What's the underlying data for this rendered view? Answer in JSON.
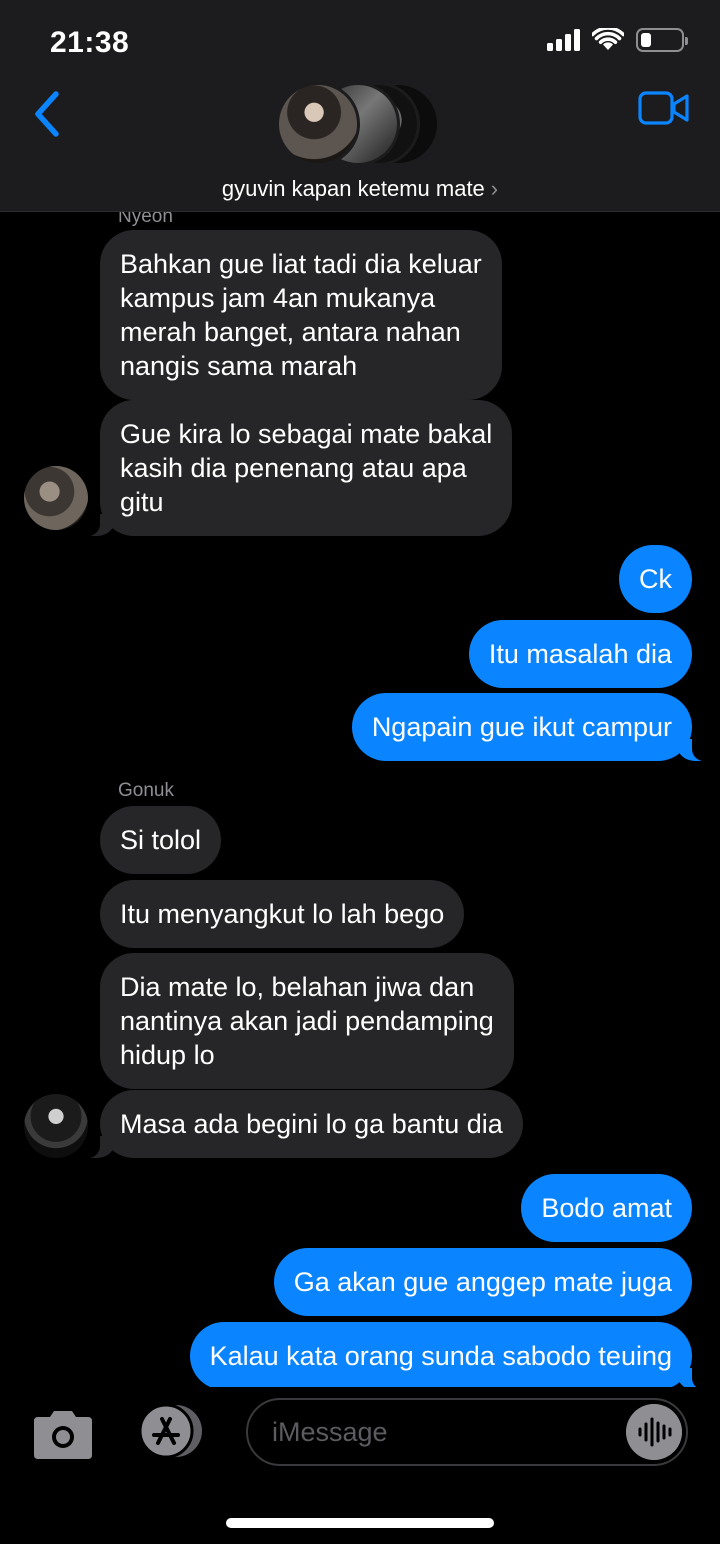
{
  "status_bar": {
    "time": "21:38",
    "battery_level": 0.25
  },
  "header": {
    "group_name": "gyuvin kapan ketemu mate",
    "chevron": "›"
  },
  "messages": [
    {
      "sender": "Nyeon"
    },
    {
      "text": "Bahkan gue liat tadi dia keluar\nkampus jam 4an mukanya\nmerah banget, antara nahan\nnangis sama marah"
    },
    {
      "text": "Gue kira lo sebagai mate bakal\nkasih dia penenang atau apa\ngitu"
    },
    {
      "text": "Ck"
    },
    {
      "text": "Itu masalah dia"
    },
    {
      "text": "Ngapain gue ikut campur"
    },
    {
      "sender": "Gonuk"
    },
    {
      "text": "Si tolol"
    },
    {
      "text": "Itu menyangkut lo lah bego"
    },
    {
      "text": "Dia mate lo, belahan jiwa dan\nnantinya akan jadi pendamping\nhidup lo"
    },
    {
      "text": "Masa ada begini lo ga bantu dia"
    },
    {
      "text": "Bodo amat"
    },
    {
      "text": "Ga akan gue anggep mate juga"
    },
    {
      "text": "Kalau kata orang sunda sabodo teuing"
    }
  ],
  "input": {
    "placeholder": "iMessage"
  },
  "colors": {
    "outgoing": "#0a84ff",
    "incoming": "#262628",
    "accent": "#0a84ff",
    "header_bg": "#1c1c1e"
  },
  "icons": [
    "back-chevron-icon",
    "video-camera-icon",
    "camera-icon",
    "app-store-icon",
    "audio-waveform-icon",
    "signal-icon",
    "wifi-icon",
    "battery-icon"
  ]
}
